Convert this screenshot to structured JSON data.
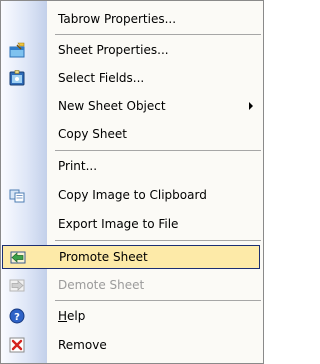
{
  "context_menu": {
    "items": [
      {
        "label": "Tabrow Properties...",
        "icon": "",
        "disabled": false
      },
      {
        "label": "Sheet Properties...",
        "icon": "sheet-properties-icon",
        "disabled": false
      },
      {
        "label": "Select Fields...",
        "icon": "select-fields-icon",
        "disabled": false
      },
      {
        "label": "New Sheet Object",
        "icon": "",
        "disabled": false,
        "submenu": true
      },
      {
        "label": "Copy Sheet",
        "icon": "",
        "disabled": false
      },
      {
        "label": "Print...",
        "icon": "",
        "disabled": false
      },
      {
        "label": "Copy Image to Clipboard",
        "icon": "copy-image-icon",
        "disabled": false
      },
      {
        "label": "Export Image to File",
        "icon": "",
        "disabled": false
      },
      {
        "label": "Promote Sheet",
        "icon": "promote-sheet-icon",
        "disabled": false,
        "highlighted": true
      },
      {
        "label": "Demote Sheet",
        "icon": "demote-sheet-icon",
        "disabled": true
      },
      {
        "label": "Help",
        "icon": "help-icon",
        "disabled": false,
        "accelerator": "H",
        "label_rest": "elp"
      },
      {
        "label": "Remove",
        "icon": "remove-icon",
        "disabled": false
      }
    ]
  },
  "colors": {
    "highlight_fill": "#fdeaa8",
    "highlight_border": "#1c2f73",
    "disabled_text": "#9b9b9b",
    "menu_background": "#fbfaf6"
  }
}
